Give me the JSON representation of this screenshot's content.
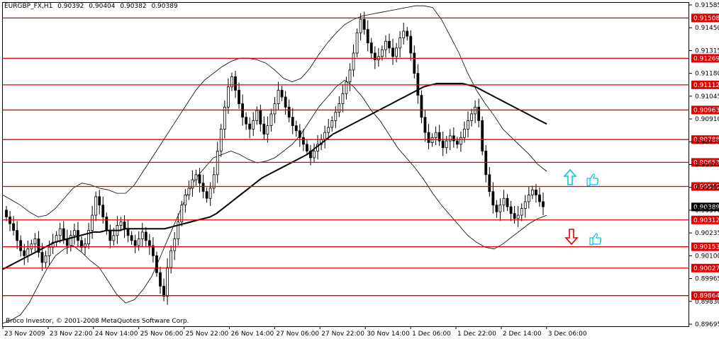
{
  "header": {
    "symbol": "EURGBP_FX,H1",
    "ohlc": [
      "0.90392",
      "0.90404",
      "0.90382",
      "0.90389"
    ]
  },
  "copyright": "Broco Investor, © 2001-2008 MetaQuotes Software Corp.",
  "colors": {
    "level_line": "#e00000",
    "level_tag": "#e00000",
    "current_tag": "#000000",
    "candle": "#000000",
    "ma": "#000000",
    "band": "#000000",
    "up_arrow": "#00c8e0",
    "down_arrow": "#e00000",
    "thumb": "#00c8e0",
    "grid": "#9aa4c0"
  },
  "chart_data": {
    "type": "candlestick",
    "title": "EURGBP_FX,H1",
    "ylim": [
      0.89695,
      0.91585
    ],
    "grid": true,
    "y_ticks": [
      "0.91585",
      "0.91450",
      "0.91315",
      "0.91180",
      "0.91045",
      "0.90910",
      "0.90775",
      "0.90640",
      "0.90505",
      "0.90370",
      "0.90235",
      "0.90100",
      "0.89965",
      "0.89830",
      "0.89695"
    ],
    "x_ticks": [
      "23 Nov 2009",
      "23 Nov 22:00",
      "24 Nov 14:00",
      "25 Nov 06:00",
      "25 Nov 22:00",
      "26 Nov 14:00",
      "27 Nov 06:00",
      "27 Nov 22:00",
      "30 Nov 14:00",
      "1 Dec 06:00",
      "1 Dec 22:00",
      "2 Dec 14:00",
      "3 Dec 06:00"
    ],
    "levels": [
      {
        "label": "0.91508",
        "value": 0.91508
      },
      {
        "label": "0.91269",
        "value": 0.91269
      },
      {
        "label": "0.91112",
        "value": 0.91112
      },
      {
        "label": "0.90963",
        "value": 0.90963
      },
      {
        "label": "0.90788",
        "value": 0.90788
      },
      {
        "label": "0.90653",
        "value": 0.90653
      },
      {
        "label": "0.90510",
        "value": 0.9051
      },
      {
        "label": "0.90312",
        "value": 0.90312
      },
      {
        "label": "0.90153",
        "value": 0.90153
      },
      {
        "label": "0.90027",
        "value": 0.90027
      },
      {
        "label": "0.89864",
        "value": 0.89864
      }
    ],
    "current_price": {
      "label": "0.90389",
      "value": 0.90389
    },
    "close": [
      0.9033,
      0.9029,
      0.9025,
      0.9019,
      0.9013,
      0.901,
      0.9014,
      0.9017,
      0.902,
      0.9012,
      0.9006,
      0.901,
      0.9015,
      0.9018,
      0.9022,
      0.9026,
      0.902,
      0.9016,
      0.9022,
      0.9025,
      0.9019,
      0.9015,
      0.9017,
      0.9025,
      0.9034,
      0.9045,
      0.904,
      0.9033,
      0.9025,
      0.9019,
      0.9022,
      0.9028,
      0.903,
      0.9026,
      0.9022,
      0.9019,
      0.9016,
      0.902,
      0.9024,
      0.9019,
      0.9016,
      0.901,
      0.9,
      0.8992,
      0.8986,
      0.9003,
      0.9013,
      0.902,
      0.903,
      0.904,
      0.9046,
      0.905,
      0.9055,
      0.9058,
      0.9053,
      0.9048,
      0.9044,
      0.905,
      0.9058,
      0.9072,
      0.9085,
      0.9098,
      0.911,
      0.9116,
      0.9108,
      0.91,
      0.9092,
      0.9088,
      0.9085,
      0.909,
      0.9096,
      0.9088,
      0.9082,
      0.9087,
      0.9094,
      0.91,
      0.9108,
      0.9104,
      0.9098,
      0.9092,
      0.9087,
      0.9084,
      0.908,
      0.9076,
      0.9072,
      0.9068,
      0.9072,
      0.9076,
      0.9079,
      0.9083,
      0.9086,
      0.909,
      0.9095,
      0.91,
      0.9106,
      0.9113,
      0.912,
      0.913,
      0.9142,
      0.915,
      0.9144,
      0.9136,
      0.913,
      0.9126,
      0.9128,
      0.9132,
      0.9137,
      0.9133,
      0.9128,
      0.9133,
      0.9139,
      0.9143,
      0.914,
      0.913,
      0.9118,
      0.9105,
      0.9092,
      0.9083,
      0.9077,
      0.908,
      0.9083,
      0.9078,
      0.9074,
      0.9078,
      0.9081,
      0.9078,
      0.9076,
      0.908,
      0.9085,
      0.909,
      0.9094,
      0.9098,
      0.909,
      0.9072,
      0.9058,
      0.9048,
      0.904,
      0.9036,
      0.904,
      0.9044,
      0.9039,
      0.9035,
      0.9032,
      0.9034,
      0.9038,
      0.9042,
      0.9046,
      0.9049,
      0.9046,
      0.9042,
      0.9039
    ],
    "ma": [
      0.9002,
      0.9004,
      0.9006,
      0.9008,
      0.901,
      0.9012,
      0.9014,
      0.9016,
      0.9018,
      0.9019,
      0.902,
      0.9021,
      0.9022,
      0.9023,
      0.9024,
      0.9024,
      0.9025,
      0.9025,
      0.9025,
      0.9026,
      0.9026,
      0.9026,
      0.9026,
      0.9026,
      0.9026,
      0.9026,
      0.9027,
      0.9028,
      0.9029,
      0.903,
      0.9031,
      0.9032,
      0.9033,
      0.9035,
      0.9038,
      0.9041,
      0.9044,
      0.9047,
      0.905,
      0.9053,
      0.9056,
      0.9058,
      0.906,
      0.9062,
      0.9064,
      0.9066,
      0.9068,
      0.907,
      0.9073,
      0.9076,
      0.9079,
      0.9082,
      0.9084,
      0.9086,
      0.9088,
      0.909,
      0.9092,
      0.9094,
      0.9096,
      0.9098,
      0.91,
      0.9102,
      0.9104,
      0.9106,
      0.9108,
      0.911,
      0.9111,
      0.9112,
      0.9112,
      0.9112,
      0.9112,
      0.9112,
      0.9111,
      0.911,
      0.9108,
      0.9106,
      0.9104,
      0.9102,
      0.91,
      0.9098,
      0.9096,
      0.9094,
      0.9092,
      0.909,
      0.9088
    ],
    "ma_x_start": 0,
    "band_upper": [
      0.9046,
      0.9043,
      0.904,
      0.9036,
      0.9033,
      0.9034,
      0.9038,
      0.9044,
      0.905,
      0.9053,
      0.9052,
      0.905,
      0.9049,
      0.9047,
      0.9047,
      0.9052,
      0.906,
      0.9068,
      0.9076,
      0.9084,
      0.9092,
      0.91,
      0.9108,
      0.9114,
      0.9118,
      0.9122,
      0.9125,
      0.9127,
      0.9127,
      0.9126,
      0.9124,
      0.912,
      0.9115,
      0.9113,
      0.9115,
      0.9121,
      0.9129,
      0.9136,
      0.9142,
      0.9147,
      0.915,
      0.9152,
      0.9153,
      0.9154,
      0.9155,
      0.9156,
      0.9157,
      0.9158,
      0.9158,
      0.9157,
      0.915,
      0.914,
      0.913,
      0.9118,
      0.9108,
      0.91,
      0.9093,
      0.9085,
      0.908,
      0.9075,
      0.907,
      0.9064,
      0.906
    ],
    "band_lower": [
      0.897,
      0.8972,
      0.8975,
      0.8982,
      0.8992,
      0.9002,
      0.901,
      0.9014,
      0.9016,
      0.9012,
      0.9007,
      0.9003,
      0.8995,
      0.8987,
      0.8982,
      0.8984,
      0.899,
      0.8998,
      0.901,
      0.9022,
      0.9034,
      0.9046,
      0.9056,
      0.9062,
      0.9068,
      0.907,
      0.9072,
      0.907,
      0.9067,
      0.9065,
      0.9066,
      0.9068,
      0.9072,
      0.9076,
      0.9082,
      0.909,
      0.9098,
      0.9104,
      0.911,
      0.9114,
      0.911,
      0.9104,
      0.9096,
      0.909,
      0.9082,
      0.9074,
      0.9068,
      0.9062,
      0.9055,
      0.9047,
      0.904,
      0.9034,
      0.9028,
      0.9022,
      0.9018,
      0.9015,
      0.9014,
      0.9017,
      0.9021,
      0.9025,
      0.9029,
      0.9032,
      0.9034
    ]
  }
}
